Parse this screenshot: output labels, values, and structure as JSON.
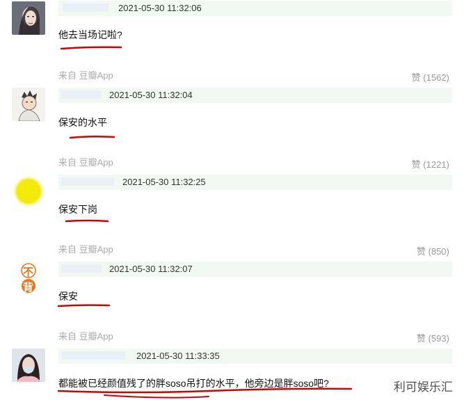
{
  "comments": [
    {
      "timestamp": "2021-05-30 11:32:06",
      "text": "他去当场记啦?",
      "source": "来自 豆瓣App",
      "like_label": "赞",
      "like_count": "(1562)"
    },
    {
      "timestamp": "2021-05-30 11:32:04",
      "text": "保安的水平",
      "source": "来自 豆瓣App",
      "like_label": "赞",
      "like_count": "(1221)"
    },
    {
      "timestamp": "2021-05-30 11:32:25",
      "text": "保安下岗",
      "source": "来自 豆瓣App",
      "like_label": "赞",
      "like_count": "(850)"
    },
    {
      "timestamp": "2021-05-30 11:32:07",
      "text": "保安",
      "source": "来自 豆瓣App",
      "like_label": "赞",
      "like_count": "(593)"
    },
    {
      "timestamp": "2021-05-30 11:33:35",
      "text": "都能被已经颜值残了的胖soso吊打的水平，他旁边是胖soso吧?"
    }
  ],
  "avatar4": {
    "top_char": "不",
    "bottom_char": "背"
  },
  "watermark": "利可娱乐汇",
  "colors": {
    "annotation_red": "#d40000",
    "header_bar": "#f2f8f2",
    "source_gray": "#aaaaaa"
  }
}
